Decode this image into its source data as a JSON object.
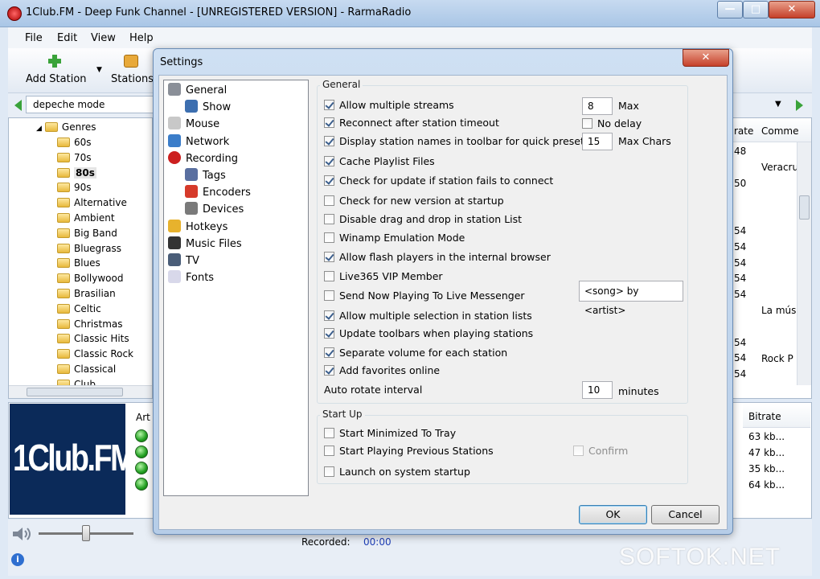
{
  "window": {
    "title": "1Club.FM - Deep Funk Channel - [UNREGISTERED VERSION] - RarmaRadio",
    "minimize_glyph": "—",
    "maximize_glyph": "□",
    "close_glyph": "✕"
  },
  "menu": [
    "File",
    "Edit",
    "View",
    "Help"
  ],
  "toolbar": {
    "add_station_label": "Add Station",
    "stations_label": "Stations"
  },
  "search": {
    "value": "depeche mode"
  },
  "genres": {
    "root_label": "Genres",
    "items": [
      "60s",
      "70s",
      "80s",
      "90s",
      "Alternative",
      "Ambient",
      "Big Band",
      "Bluegrass",
      "Blues",
      "Bollywood",
      "Brasilian",
      "Celtic",
      "Christmas",
      "Classic Hits",
      "Classic Rock",
      "Classical",
      "Club"
    ],
    "selected": "80s"
  },
  "station_list": {
    "columns": [
      "rate",
      "Comme"
    ],
    "bitrate_col_values": [
      "48",
      "",
      "50",
      "",
      "",
      "54",
      "54",
      "54",
      "54",
      "54",
      "",
      "",
      "54",
      "54",
      "54"
    ],
    "comment_values": [
      "Veracru",
      "La mús",
      "Rock P"
    ]
  },
  "playlist": {
    "columns": [
      "Art",
      "Bitrate"
    ],
    "bitrates": [
      "63 kb...",
      "47 kb...",
      "35 kb...",
      "64 kb..."
    ]
  },
  "logo_text": "1Club.FM",
  "status": {
    "recorded_label": "Recorded:",
    "recorded_value": "00:00"
  },
  "dialog": {
    "title": "Settings",
    "close_glyph": "✕",
    "nav": [
      {
        "label": "General",
        "indent": false
      },
      {
        "label": "Show",
        "indent": true
      },
      {
        "label": "Mouse",
        "indent": false
      },
      {
        "label": "Network",
        "indent": false
      },
      {
        "label": "Recording",
        "indent": false
      },
      {
        "label": "Tags",
        "indent": true
      },
      {
        "label": "Encoders",
        "indent": true
      },
      {
        "label": "Devices",
        "indent": true
      },
      {
        "label": "Hotkeys",
        "indent": false
      },
      {
        "label": "Music Files",
        "indent": false
      },
      {
        "label": "TV",
        "indent": false
      },
      {
        "label": "Fonts",
        "indent": false
      }
    ],
    "general": {
      "title": "General",
      "options": [
        {
          "label": "Allow multiple streams",
          "checked": true
        },
        {
          "label": "Reconnect after station timeout",
          "checked": true
        },
        {
          "label": "Display station names in toolbar for quick preset",
          "checked": true
        },
        {
          "label": "Cache Playlist Files",
          "checked": true
        },
        {
          "label": "Check for update if station fails to connect",
          "checked": true
        },
        {
          "label": "Check for new version at startup",
          "checked": false
        },
        {
          "label": "Disable drag and drop in station List",
          "checked": false
        },
        {
          "label": "Winamp Emulation Mode",
          "checked": false
        },
        {
          "label": "Allow flash players in the internal browser",
          "checked": true
        },
        {
          "label": "Live365 VIP Member",
          "checked": false
        },
        {
          "label": "Send Now Playing To Live Messenger",
          "checked": false
        },
        {
          "label": "Allow multiple selection in station lists",
          "checked": true
        },
        {
          "label": "Update toolbars when playing stations",
          "checked": true
        },
        {
          "label": "Separate volume for each station",
          "checked": true
        },
        {
          "label": "Add favorites online",
          "checked": true
        }
      ],
      "max_streams_value": "8",
      "max_label": "Max",
      "no_delay_label": "No delay",
      "max_chars_value": "15",
      "max_chars_label": "Max Chars",
      "messenger_format": "<song> by <artist>",
      "auto_rotate_label": "Auto rotate interval",
      "auto_rotate_value": "10",
      "minutes_label": "minutes"
    },
    "startup": {
      "title": "Start Up",
      "options": [
        {
          "label": "Start Minimized To Tray",
          "checked": false
        },
        {
          "label": "Start Playing Previous Stations",
          "checked": false
        },
        {
          "label": "Launch on system startup",
          "checked": false
        }
      ],
      "confirm_label": "Confirm"
    },
    "ok_label": "OK",
    "cancel_label": "Cancel"
  },
  "watermark": "SOFTOK.NET"
}
